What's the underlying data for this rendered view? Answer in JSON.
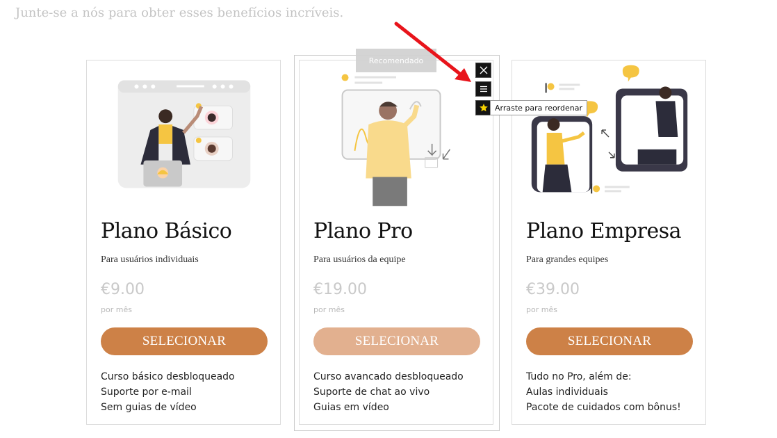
{
  "intro_text": "Junte-se a nós para obter esses benefícios incríveis.",
  "recommended_badge": "Recomendado",
  "toolbar": {
    "close_icon": "close-icon",
    "drag_icon": "drag-handle-icon",
    "star_icon": "star-icon",
    "drag_tooltip": "Arraste para reordenar"
  },
  "plans": [
    {
      "title": "Plano Básico",
      "subtitle": "Para usuários individuais",
      "price": "€9.00",
      "period": "por mês",
      "button": "SELECIONAR",
      "features": [
        "Curso básico desbloqueado",
        "Suporte por e-mail",
        "Sem guias de vídeo"
      ]
    },
    {
      "title": "Plano Pro",
      "subtitle": "Para usuários da equipe",
      "price": "€19.00",
      "period": "por mês",
      "button": "SELECIONAR",
      "features": [
        "Curso avancado desbloqueado",
        "Suporte de chat ao vivo",
        "Guias em vídeo"
      ]
    },
    {
      "title": "Plano Empresa",
      "subtitle": "Para grandes equipes",
      "price": "€39.00",
      "period": "por mês",
      "button": "SELECIONAR",
      "features": [
        "Tudo no Pro, além de:",
        "Aulas individuais",
        "Pacote de cuidados com bônus!"
      ]
    }
  ],
  "colors": {
    "button": "#cd8147",
    "button_hover": "#e2b08f",
    "accent_yellow": "#f5c542",
    "annotation_arrow": "#e8141b"
  }
}
